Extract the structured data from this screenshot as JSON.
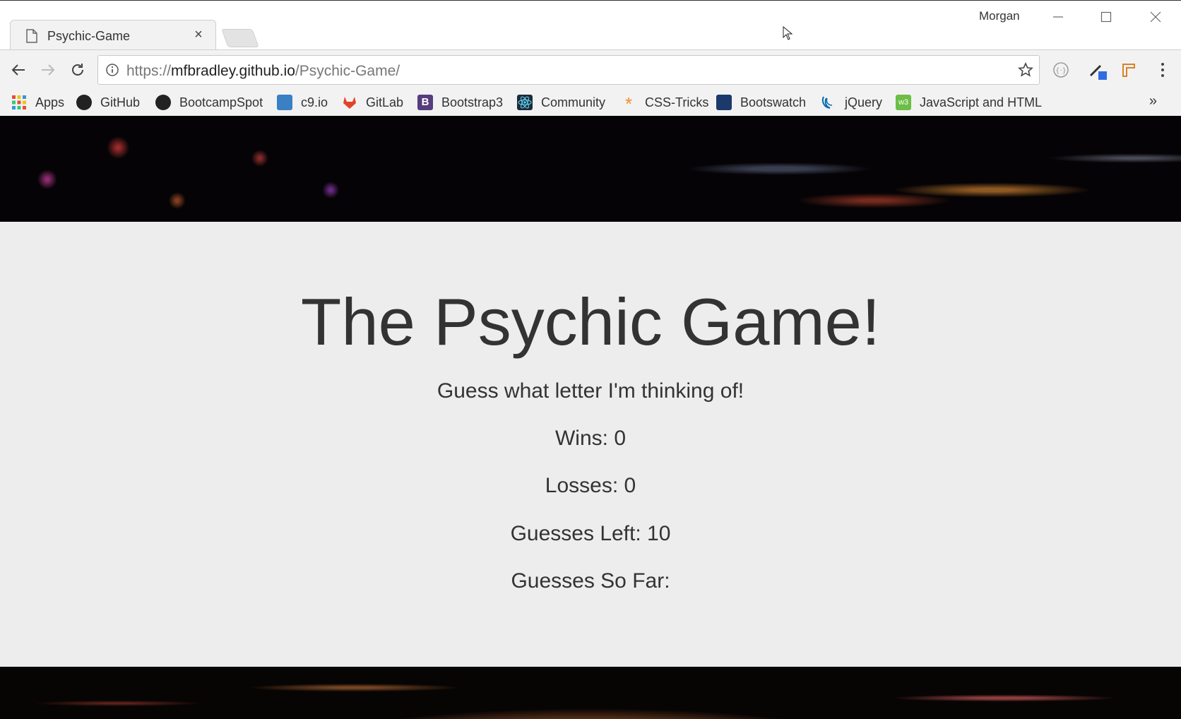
{
  "browser": {
    "tab": {
      "title": "Psychic-Game",
      "close": "×"
    },
    "profile": "Morgan",
    "window_controls": {
      "minimize": "—",
      "maximize": "☐",
      "close": "✕"
    },
    "url": {
      "scheme": "https://",
      "host": "mfbradley.github.io",
      "path": "/Psychic-Game/"
    },
    "icons": {
      "back": "back-arrow-icon",
      "forward": "forward-arrow-icon",
      "reload": "reload-icon",
      "info": "info-icon",
      "star": "bookmark-star-icon",
      "menu": "kebab-menu-icon"
    },
    "bookmarks": [
      {
        "label": "Apps",
        "icon": "apps-grid-icon",
        "color": "#e74c3c"
      },
      {
        "label": "GitHub",
        "icon": "github-icon",
        "color": "#222222"
      },
      {
        "label": "BootcampSpot",
        "icon": "github-icon",
        "color": "#222222"
      },
      {
        "label": "c9.io",
        "icon": "cloud9-icon",
        "color": "#3b7fc4"
      },
      {
        "label": "GitLab",
        "icon": "gitlab-icon",
        "color": "#e2432a"
      },
      {
        "label": "Bootstrap3",
        "icon": "bootstrap-icon",
        "color": "#563d7c"
      },
      {
        "label": "Community",
        "icon": "react-icon",
        "color": "#1e2b3a"
      },
      {
        "label": "CSS-Tricks",
        "icon": "asterisk-icon",
        "color": "#f08d2e"
      },
      {
        "label": "Bootswatch",
        "icon": "bootswatch-icon",
        "color": "#1b3a6b"
      },
      {
        "label": "jQuery",
        "icon": "jquery-icon",
        "color": "#0769ad"
      },
      {
        "label": "JavaScript and HTML",
        "icon": "w3-icon",
        "color": "#6cbe45"
      }
    ],
    "more": "»"
  },
  "game": {
    "title": "The Psychic Game!",
    "subtitle": "Guess what letter I'm thinking of!",
    "wins": "Wins: 0",
    "losses": "Losses: 0",
    "guesses_left": "Guesses Left: 10",
    "guesses_so_far": "Guesses So Far:"
  }
}
